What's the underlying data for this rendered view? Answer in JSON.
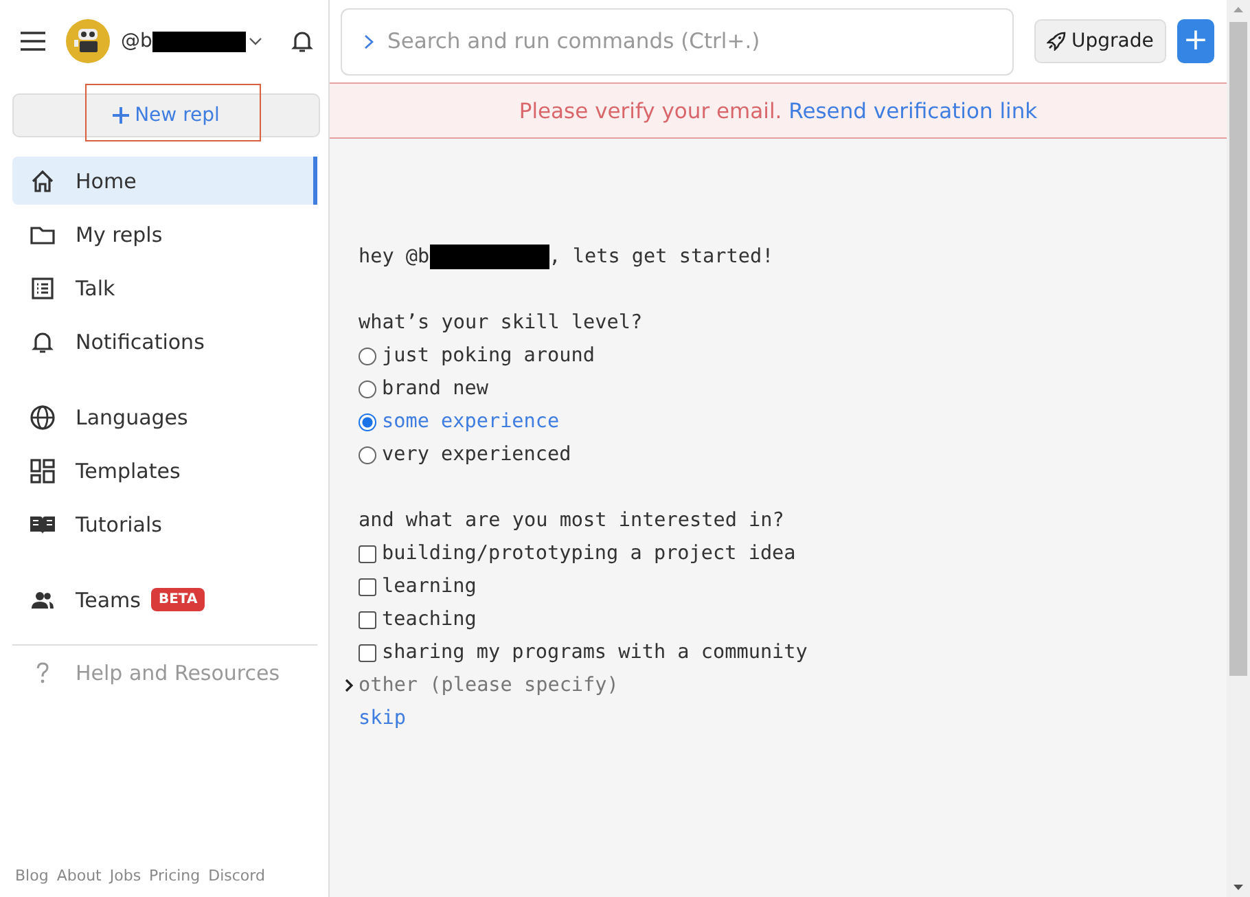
{
  "sidebar": {
    "user": {
      "handle": "@b"
    },
    "new_repl": "New repl",
    "nav_groups": [
      [
        {
          "label": "Home",
          "selected": true
        },
        {
          "label": "My repls",
          "selected": false
        },
        {
          "label": "Talk",
          "selected": false
        },
        {
          "label": "Notifications",
          "selected": false
        }
      ],
      [
        {
          "label": "Languages",
          "selected": false
        },
        {
          "label": "Templates",
          "selected": false
        },
        {
          "label": "Tutorials",
          "selected": false
        }
      ],
      [
        {
          "label": "Teams",
          "selected": false,
          "badge": "BETA"
        }
      ]
    ],
    "help": "Help and Resources",
    "footer_links": [
      "Blog",
      "About",
      "Jobs",
      "Pricing",
      "Discord"
    ]
  },
  "topbar": {
    "search": {
      "placeholder": "Search and run commands (Ctrl+.)"
    },
    "upgrade": "Upgrade",
    "new": "+"
  },
  "banner": {
    "message": "Please verify your email.",
    "link": "Resend verification link"
  },
  "survey": {
    "greeting_start": "hey @b",
    "greeting_end": ", lets get started!",
    "skill_question": "what’s your skill level?",
    "skill_options": [
      {
        "label": "just poking around",
        "selected": false
      },
      {
        "label": "brand new",
        "selected": false
      },
      {
        "label": "some experience",
        "selected": true
      },
      {
        "label": "very experienced",
        "selected": false
      }
    ],
    "interest_question": "and what are you most interested in?",
    "interests": [
      {
        "label": "building/prototyping a project idea",
        "checked": false
      },
      {
        "label": "learning",
        "checked": false
      },
      {
        "label": "teaching",
        "checked": false
      },
      {
        "label": "sharing my programs with a community",
        "checked": false
      }
    ],
    "other": {
      "label": "other (please specify)",
      "expanded": false
    },
    "skip": "skip"
  }
}
